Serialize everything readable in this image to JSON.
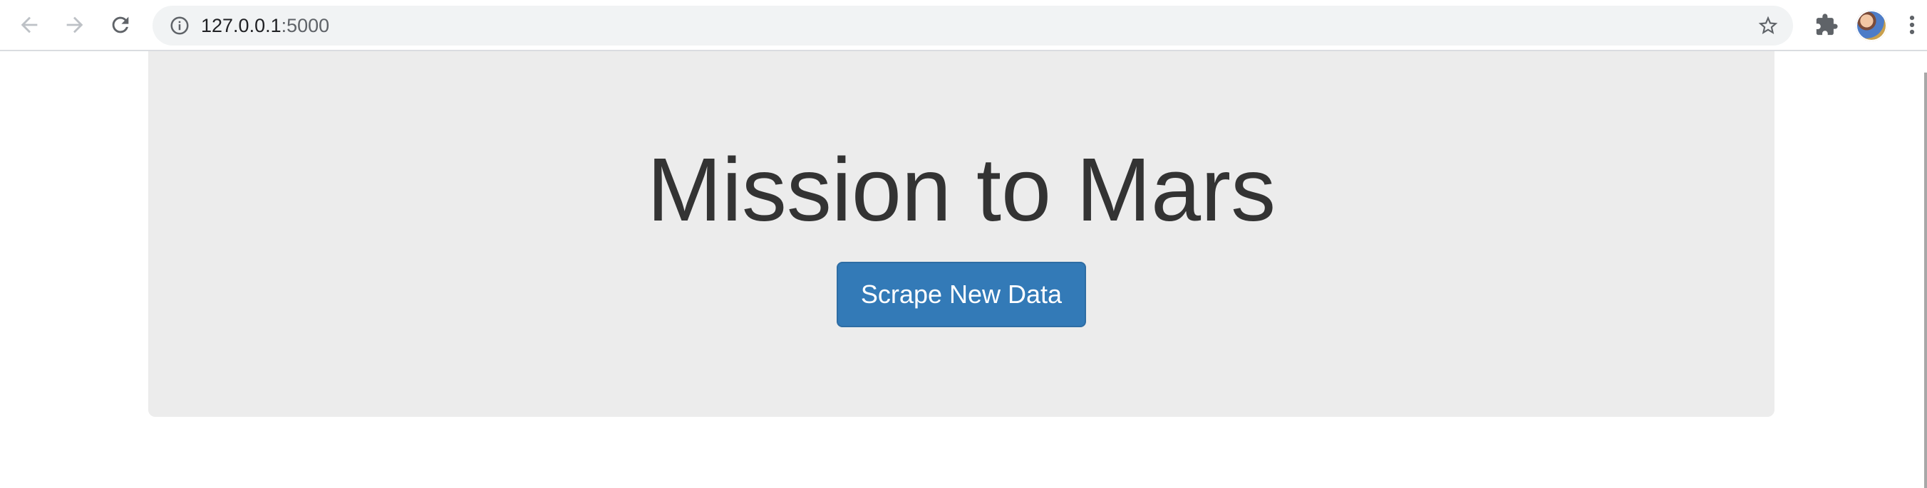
{
  "browser": {
    "url_host": "127.0.0.1",
    "url_port": ":5000",
    "icons": {
      "back": "arrow-back-icon",
      "forward": "arrow-forward-icon",
      "reload": "reload-icon",
      "site_info": "info-icon",
      "bookmark": "star-icon",
      "extensions": "puzzle-icon",
      "menu": "kebab-menu-icon"
    },
    "colors": {
      "toolbar": "#ffffff",
      "omnibox": "#f1f3f4",
      "icon": "#5f6368",
      "icon_disabled": "#bdc1c6"
    }
  },
  "page": {
    "title": "Mission to Mars",
    "scrape_button_label": "Scrape New Data",
    "colors": {
      "jumbotron_bg": "#ececec",
      "title_text": "#333333",
      "button_bg": "#337ab7",
      "button_border": "#2e6da4",
      "button_text": "#ffffff"
    }
  }
}
